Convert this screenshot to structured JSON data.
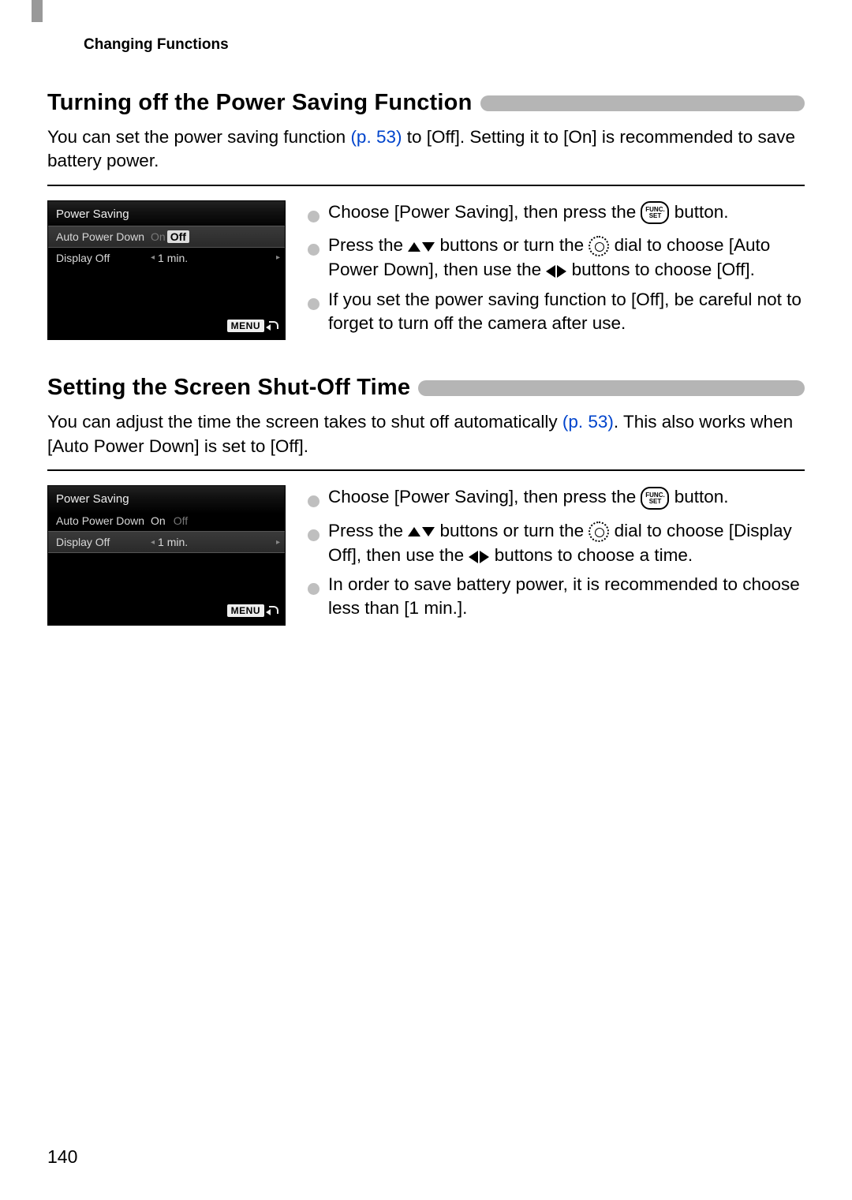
{
  "header": "Changing Functions",
  "page_number": "140",
  "section1": {
    "title": "Turning off the Power Saving Function",
    "intro_pre": "You can set the power saving function ",
    "page_ref": "(p. 53)",
    "intro_post": " to [Off]. Setting it to [On] is recommended to save battery power.",
    "screen": {
      "title": "Power Saving",
      "row1_label": "Auto Power Down",
      "row1_opt_on": "On",
      "row1_opt_off": "Off",
      "row2_label": "Display Off",
      "row2_value": "1 min.",
      "menu": "MENU"
    },
    "bullets": {
      "b1_pre": "Choose [Power Saving], then press the ",
      "b1_post": " button.",
      "b2_pre": "Press the ",
      "b2_mid1": " buttons or turn the ",
      "b2_mid2": " dial to choose [Auto Power Down], then use the ",
      "b2_post": " buttons to choose [Off].",
      "b3": "If you set the power saving function to [Off], be careful not to forget to turn off the camera after use."
    }
  },
  "section2": {
    "title": "Setting the Screen Shut-Off Time",
    "intro_pre": "You can adjust the time the screen takes to shut off automatically ",
    "page_ref": "(p. 53)",
    "intro_post": ". This also works when [Auto Power Down] is set to [Off].",
    "screen": {
      "title": "Power Saving",
      "row1_label": "Auto Power Down",
      "row1_value_on": "On",
      "row1_value_off": "Off",
      "row2_label": "Display Off",
      "row2_value": "1 min.",
      "menu": "MENU"
    },
    "bullets": {
      "b1_pre": "Choose [Power Saving], then press the ",
      "b1_post": " button.",
      "b2_pre": "Press the ",
      "b2_mid1": " buttons or turn the ",
      "b2_mid2": " dial to choose [Display Off], then use the ",
      "b2_post": " buttons to choose a time.",
      "b3": "In order to save battery power, it is recommended to choose less than [1 min.]."
    }
  },
  "icons": {
    "func_top": "FUNC.",
    "func_bot": "SET"
  }
}
